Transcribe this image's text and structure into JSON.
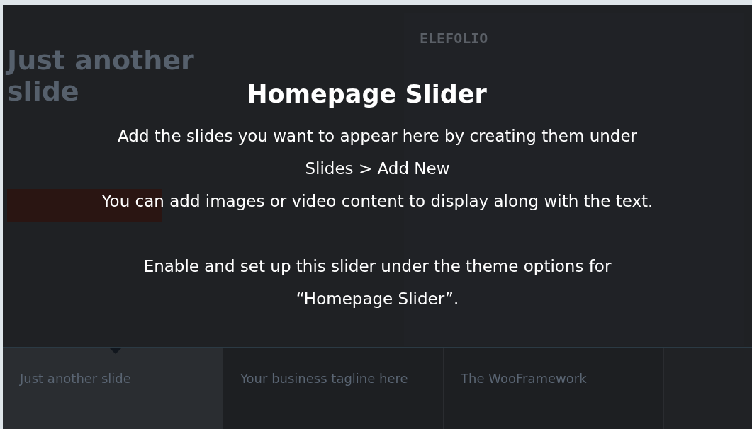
{
  "background_slide": {
    "title": "Just another slide"
  },
  "preview": {
    "logo": "ELEFOLIO"
  },
  "overlay": {
    "title": "Homepage Slider",
    "paragraphs": [
      {
        "lines": [
          "Add the slides you want to appear here by creating them under",
          "Slides > Add New",
          "You can add images or video content to display along with the text."
        ]
      },
      {
        "lines": [
          "Enable and set up this slider under the theme options for",
          "“Homepage Slider”."
        ]
      }
    ]
  },
  "slide_tabs": [
    {
      "title": "Just another slide",
      "selected": true
    },
    {
      "title": "Your business tagline here",
      "selected": false
    },
    {
      "title": "The WooFramework",
      "selected": false
    }
  ]
}
